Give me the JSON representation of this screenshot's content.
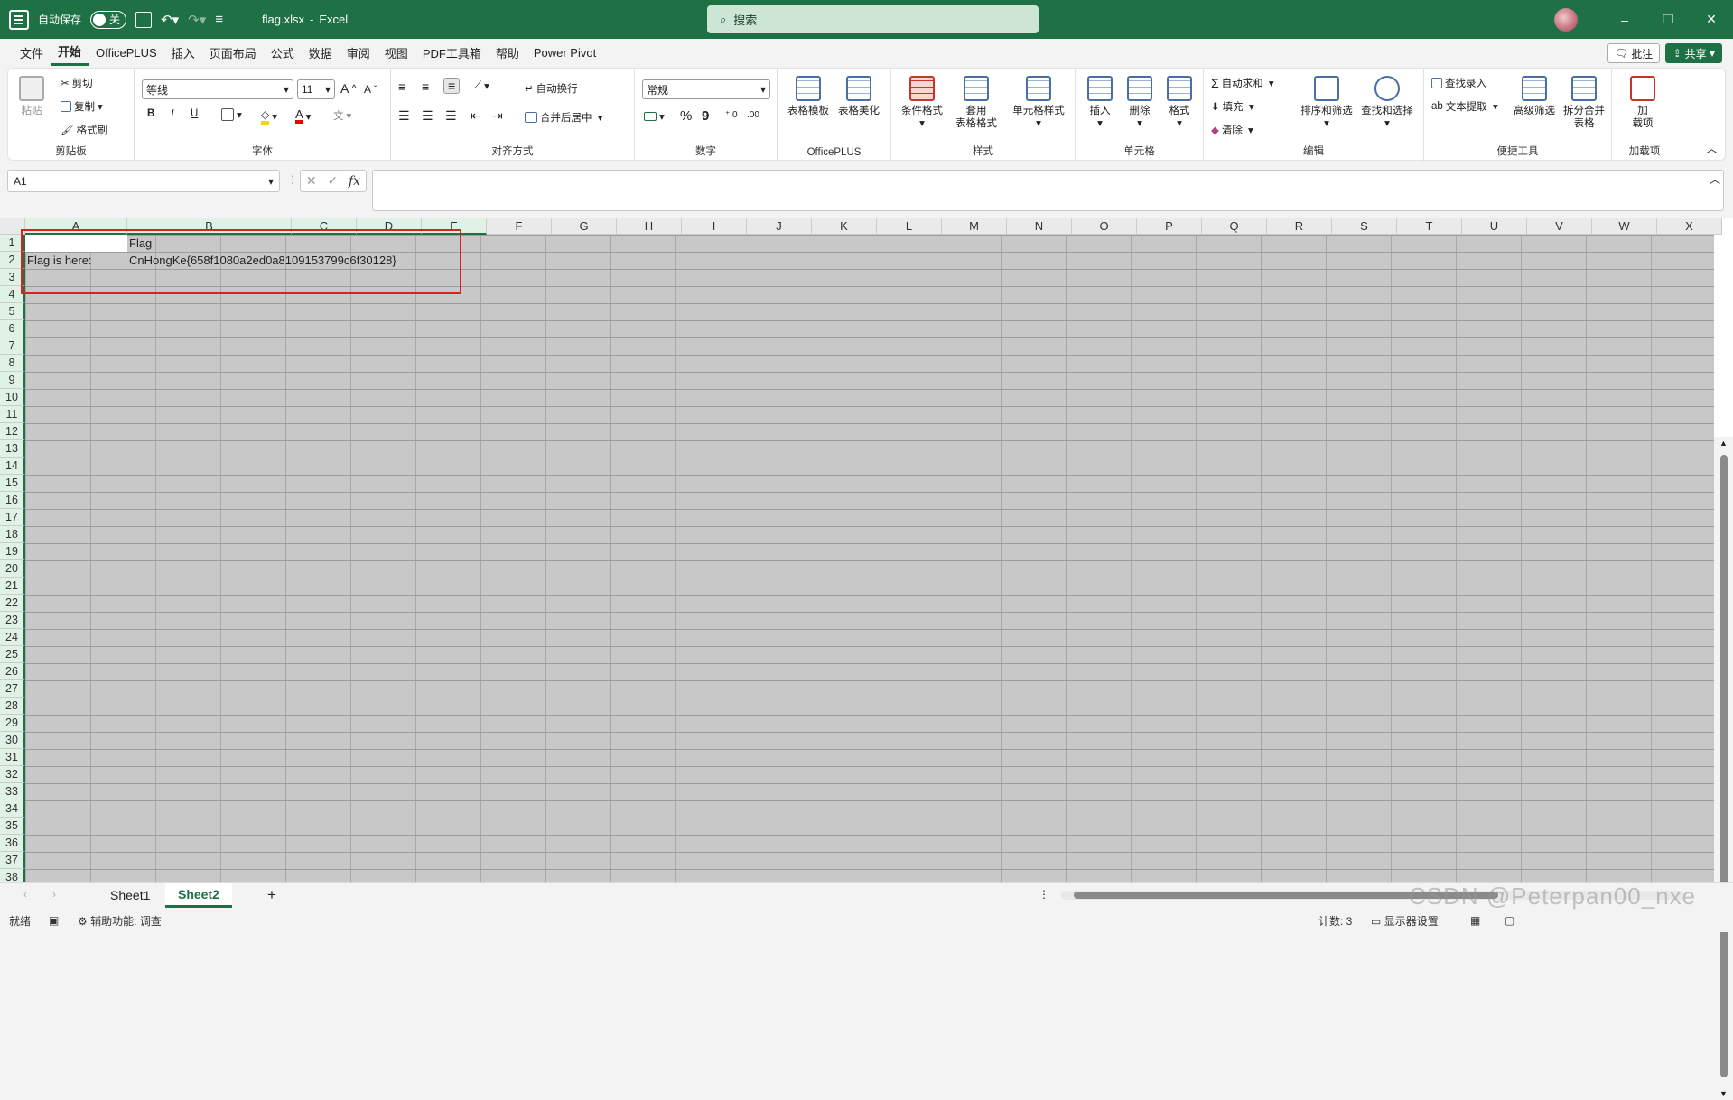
{
  "titlebar": {
    "autosave_label": "自动保存",
    "autosave_state": "关",
    "filename": "flag.xlsx",
    "separator": "-",
    "app": "Excel",
    "search_placeholder": "搜索",
    "minimize": "–",
    "maximize": "❐",
    "close": "✕"
  },
  "menu": {
    "items": [
      "文件",
      "开始",
      "OfficePLUS",
      "插入",
      "页面布局",
      "公式",
      "数据",
      "审阅",
      "视图",
      "PDF工具箱",
      "帮助",
      "Power Pivot"
    ],
    "active": "开始",
    "comment_btn": "批注",
    "share_btn": "共享"
  },
  "ribbon": {
    "clipboard": {
      "paste": "粘贴",
      "cut": "剪切",
      "copy": "复制",
      "format_painter": "格式刷",
      "label": "剪贴板"
    },
    "font": {
      "name": "等线",
      "size": "11",
      "bold": "B",
      "italic": "I",
      "underline": "U",
      "label": "字体"
    },
    "align": {
      "wrap": "自动换行",
      "merge": "合并后居中",
      "label": "对齐方式"
    },
    "number": {
      "format": "常规",
      "percent": "%",
      "comma": "9",
      "label": "数字"
    },
    "officeplus": {
      "template": "表格模板",
      "beautify": "表格美化",
      "label": "OfficePLUS"
    },
    "styles": {
      "conditional": "条件格式",
      "table_style": "套用\n表格格式",
      "cell_style": "单元格样式",
      "label": "样式"
    },
    "cells": {
      "insert": "插入",
      "delete": "删除",
      "format": "格式",
      "label": "单元格"
    },
    "editing": {
      "autosum": "自动求和",
      "fill": "填充",
      "clear": "清除",
      "sort": "排序和筛选",
      "find": "查找和选择",
      "label": "编辑"
    },
    "tools": {
      "lookup": "查找录入",
      "extract": "文本提取",
      "advfilter": "高级筛选",
      "splitmerge": "拆分合并\n表格",
      "label": "便捷工具"
    },
    "addins": {
      "addin": "加\n载项",
      "label": "加载项"
    }
  },
  "formula": {
    "namebox": "A1",
    "fx": "fx",
    "content": ""
  },
  "columns": [
    "A",
    "B",
    "C",
    "D",
    "E",
    "F",
    "G",
    "H",
    "I",
    "J",
    "K",
    "L",
    "M",
    "N",
    "O",
    "P",
    "Q",
    "R",
    "S",
    "T",
    "U",
    "V",
    "W",
    "X"
  ],
  "rows": [
    "1",
    "2",
    "3",
    "4",
    "5",
    "6",
    "7",
    "8",
    "9",
    "10",
    "11",
    "12",
    "13",
    "14",
    "15",
    "16",
    "17",
    "18",
    "19",
    "20",
    "21",
    "22",
    "23",
    "24",
    "25",
    "26",
    "27",
    "28",
    "29",
    "30",
    "31",
    "32",
    "33",
    "34",
    "35",
    "36",
    "37",
    "38"
  ],
  "cells": {
    "B1": "Flag",
    "A2": "Flag is here:",
    "B2": "CnHongKe{658f1080a2ed0a8109153799c6f30128}"
  },
  "sheets": {
    "tabs": [
      "Sheet1",
      "Sheet2"
    ],
    "active": "Sheet2",
    "add": "+"
  },
  "status": {
    "ready": "就绪",
    "accessibility": "辅助功能: 调查",
    "count": "计数: 3",
    "display": "显示器设置"
  },
  "watermark": "CSDN @Peterpan00_nxe"
}
